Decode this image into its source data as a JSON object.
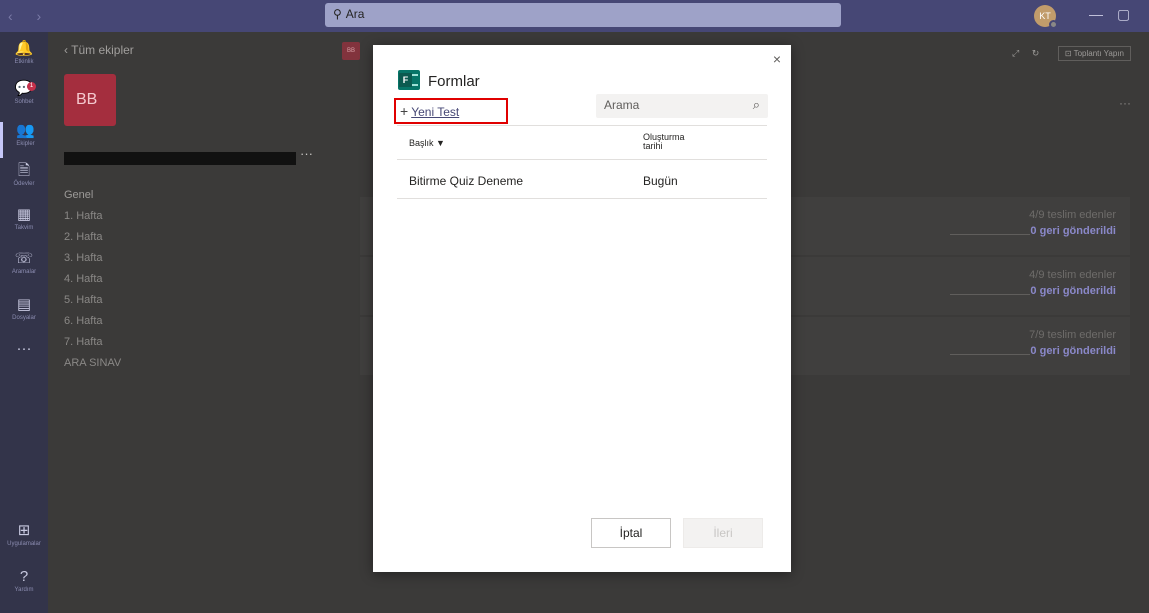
{
  "titlebar": {
    "nav": "‹ ›",
    "search_placeholder": "Ara",
    "user_initials": "KT",
    "minimize": "—",
    "maximize": "▢"
  },
  "rail": [
    {
      "label": "Etkinlik",
      "icon": "bell-icon",
      "glyph": "🔔"
    },
    {
      "label": "Sohbet",
      "icon": "chat-icon",
      "glyph": "💬",
      "badge": "1"
    },
    {
      "label": "Ekipler",
      "icon": "teams-icon",
      "glyph": "👥",
      "active": true
    },
    {
      "label": "Ödevler",
      "icon": "assignments-icon",
      "glyph": "🗎"
    },
    {
      "label": "Takvim",
      "icon": "calendar-icon",
      "glyph": "▦"
    },
    {
      "label": "Aramalar",
      "icon": "phone-icon",
      "glyph": "☏"
    },
    {
      "label": "Dosyalar",
      "icon": "files-icon",
      "glyph": "▤"
    },
    {
      "label": "",
      "icon": "more-icon",
      "glyph": "···"
    }
  ],
  "rail_bottom": [
    {
      "label": "Uygulamalar",
      "icon": "apps-icon",
      "glyph": "⊞"
    },
    {
      "label": "Yardım",
      "icon": "help-icon",
      "glyph": "?"
    }
  ],
  "teampanel": {
    "back_label": "‹  Tüm ekipler",
    "team_initials": "BB",
    "more": "···",
    "channels": [
      "Genel",
      "1. Hafta",
      "2. Hafta",
      "3. Hafta",
      "4. Hafta",
      "5. Hafta",
      "6. Hafta",
      "7. Hafta",
      "ARA SINAV"
    ]
  },
  "main": {
    "badge_initials": "BB",
    "meeting_button": "⊡ Toplantı Yapın",
    "more": "···",
    "rows": [
      {
        "submitted": "4/9 teslim edenler",
        "returned": "0 geri gönderildi"
      },
      {
        "submitted": "4/9 teslim edenler",
        "returned": "0 geri gönderildi"
      },
      {
        "submitted": "7/9 teslim edenler",
        "returned": "0 geri gönderildi"
      }
    ]
  },
  "dialog": {
    "title": "Formlar",
    "close": "×",
    "new_test_plus": "+",
    "new_test_label": "Yeni Test",
    "search_placeholder": "Arama",
    "search_icon": "⌕",
    "col_title": "Başlık ▼",
    "col_created_1": "Oluşturma",
    "col_created_2": "tarihi",
    "items": [
      {
        "title": "Bitirme Quiz Deneme",
        "created": "Bugün"
      }
    ],
    "cancel_label": "İptal",
    "next_label": "İleri"
  }
}
